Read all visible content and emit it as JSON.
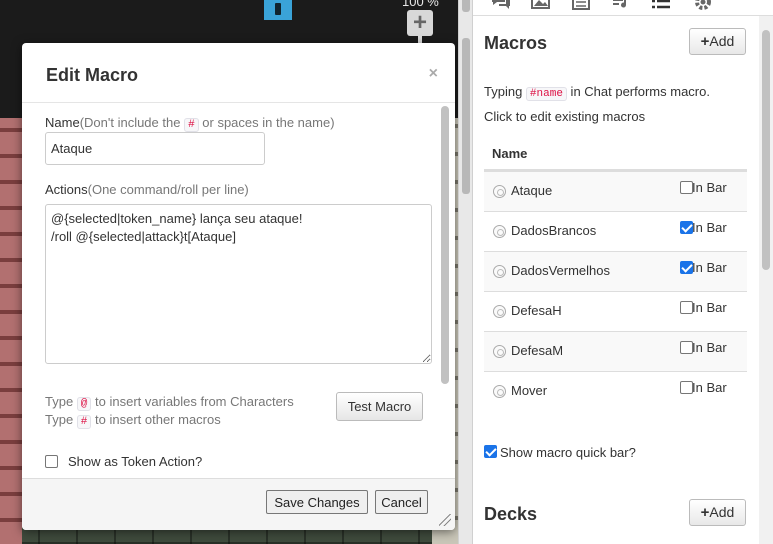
{
  "canvas": {
    "zoom_label": "100 %",
    "zoom_in_symbol": "+"
  },
  "dialog": {
    "title": "Edit Macro",
    "close_symbol": "×",
    "name_label": "Name",
    "name_hint_pre": "(Don't include the ",
    "name_hint_code": "#",
    "name_hint_post": " or spaces in the name)",
    "name_value": "Ataque",
    "actions_label": "Actions",
    "actions_hint": "(One command/roll per line)",
    "actions_value": "@{selected|token_name} lança seu ataque!\n/roll @{selected|attack}t[Ataque]",
    "help1_pre": "Type ",
    "help1_code": "@",
    "help1_post": " to insert variables from Characters",
    "help2_pre": "Type ",
    "help2_code": "#",
    "help2_post": " to insert other macros",
    "test_button": "Test Macro",
    "token_action_label": "Show as Token Action?",
    "token_action_checked": false,
    "save_button": "Save Changes",
    "cancel_button": "Cancel"
  },
  "sidebar": {
    "tab_icons": [
      "chat-icon",
      "image-icon",
      "journal-icon",
      "jukebox-icon",
      "collection-icon",
      "settings-icon"
    ],
    "macros_title": "Macros",
    "add_label": "Add",
    "info_pre": "Typing ",
    "info_code": "#name",
    "info_post": " in Chat performs macro.",
    "info2": "Click to edit existing macros",
    "table_header": "Name",
    "in_bar_label": "In Bar",
    "macros": [
      {
        "name": "Ataque",
        "in_bar": false
      },
      {
        "name": "DadosBrancos",
        "in_bar": true
      },
      {
        "name": "DadosVermelhos",
        "in_bar": true
      },
      {
        "name": "DefesaH",
        "in_bar": false
      },
      {
        "name": "DefesaM",
        "in_bar": false
      },
      {
        "name": "Mover",
        "in_bar": false
      }
    ],
    "quickbar_label": "Show macro quick bar?",
    "quickbar_checked": true,
    "decks_title": "Decks",
    "decks_add_label": "Add"
  },
  "colors": {
    "accent_blue": "#1a73e8",
    "token_marker": "#3aa3d8"
  }
}
